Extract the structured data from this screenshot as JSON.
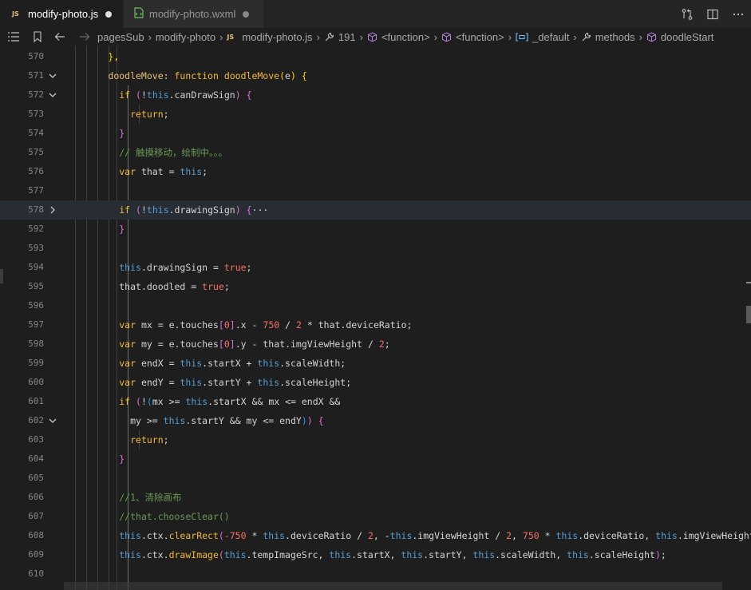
{
  "tabs": [
    {
      "label": "modify-photo.js",
      "icon": "javascript-file-icon",
      "active": true,
      "modified": true
    },
    {
      "label": "modify-photo.wxml",
      "icon": "wxml-file-icon",
      "active": false,
      "modified": true
    }
  ],
  "breadcrumb": [
    {
      "label": "pagesSub",
      "icon": ""
    },
    {
      "label": "modify-photo",
      "icon": ""
    },
    {
      "label": "modify-photo.js",
      "icon": "javascript-file-icon"
    },
    {
      "label": "191",
      "icon": "wrench-icon"
    },
    {
      "label": "<function>",
      "icon": "cube-icon"
    },
    {
      "label": "<function>",
      "icon": "cube-icon"
    },
    {
      "label": "_default",
      "icon": "variable-icon"
    },
    {
      "label": "methods",
      "icon": "wrench-icon"
    },
    {
      "label": "doodleStart",
      "icon": "cube-icon"
    }
  ],
  "colors": {
    "punctuation": "#d4d4d4",
    "keyword": "#569cd6",
    "storage": "#f5b83d",
    "property": "#e5c07b",
    "identifier": "#d4d4d4",
    "comment": "#6a9955",
    "function": "#f0b742",
    "number": "#f47067",
    "boolean": "#f47067",
    "bracket1": "#ffd700",
    "bracket2": "#da70d6",
    "bracket3": "#179fff",
    "operator": "#d4d4d4"
  },
  "current_line": 578,
  "lines": [
    {
      "n": 570,
      "fold": "",
      "tokens": [
        {
          "t": "        ",
          "c": "identifier"
        },
        {
          "t": "},",
          "c": "bracket1"
        }
      ]
    },
    {
      "n": 571,
      "fold": "open",
      "tokens": [
        {
          "t": "        ",
          "c": "identifier"
        },
        {
          "t": "doodleMove",
          "c": "property"
        },
        {
          "t": ": ",
          "c": "punctuation"
        },
        {
          "t": "function",
          "c": "storage"
        },
        {
          "t": " ",
          "c": "identifier"
        },
        {
          "t": "doodleMove",
          "c": "function"
        },
        {
          "t": "(",
          "c": "bracket1"
        },
        {
          "t": "e",
          "c": "identifier"
        },
        {
          "t": ")",
          "c": "bracket1"
        },
        {
          "t": " ",
          "c": "identifier"
        },
        {
          "t": "{",
          "c": "bracket1"
        }
      ]
    },
    {
      "n": 572,
      "fold": "open",
      "tokens": [
        {
          "t": "          ",
          "c": "identifier"
        },
        {
          "t": "if",
          "c": "storage"
        },
        {
          "t": " ",
          "c": "identifier"
        },
        {
          "t": "(",
          "c": "bracket2"
        },
        {
          "t": "!",
          "c": "operator"
        },
        {
          "t": "this",
          "c": "keyword"
        },
        {
          "t": ".canDrawSign",
          "c": "identifier"
        },
        {
          "t": ")",
          "c": "bracket2"
        },
        {
          "t": " ",
          "c": "identifier"
        },
        {
          "t": "{",
          "c": "bracket2"
        }
      ]
    },
    {
      "n": 573,
      "fold": "",
      "tokens": [
        {
          "t": "            ",
          "c": "identifier"
        },
        {
          "t": "return",
          "c": "storage"
        },
        {
          "t": ";",
          "c": "punctuation"
        }
      ]
    },
    {
      "n": 574,
      "fold": "",
      "tokens": [
        {
          "t": "          ",
          "c": "identifier"
        },
        {
          "t": "}",
          "c": "bracket2"
        }
      ]
    },
    {
      "n": 575,
      "fold": "",
      "tokens": [
        {
          "t": "          ",
          "c": "identifier"
        },
        {
          "t": "// 触摸移动，绘制中。。。",
          "c": "comment"
        }
      ]
    },
    {
      "n": 576,
      "fold": "",
      "tokens": [
        {
          "t": "          ",
          "c": "identifier"
        },
        {
          "t": "var",
          "c": "storage"
        },
        {
          "t": " that ",
          "c": "identifier"
        },
        {
          "t": "=",
          "c": "operator"
        },
        {
          "t": " ",
          "c": "identifier"
        },
        {
          "t": "this",
          "c": "keyword"
        },
        {
          "t": ";",
          "c": "punctuation"
        }
      ]
    },
    {
      "n": 577,
      "fold": "",
      "tokens": []
    },
    {
      "n": 578,
      "fold": "closed",
      "tokens": [
        {
          "t": "          ",
          "c": "identifier"
        },
        {
          "t": "if",
          "c": "storage"
        },
        {
          "t": " ",
          "c": "identifier"
        },
        {
          "t": "(",
          "c": "bracket2"
        },
        {
          "t": "!",
          "c": "operator"
        },
        {
          "t": "this",
          "c": "keyword"
        },
        {
          "t": ".drawingSign",
          "c": "identifier"
        },
        {
          "t": ")",
          "c": "bracket2"
        },
        {
          "t": " ",
          "c": "identifier"
        },
        {
          "t": "{",
          "c": "bracket2"
        },
        {
          "t": "···",
          "c": "identifier"
        }
      ]
    },
    {
      "n": 592,
      "fold": "",
      "tokens": [
        {
          "t": "          ",
          "c": "identifier"
        },
        {
          "t": "}",
          "c": "bracket2"
        }
      ]
    },
    {
      "n": 593,
      "fold": "",
      "tokens": []
    },
    {
      "n": 594,
      "fold": "",
      "tokens": [
        {
          "t": "          ",
          "c": "identifier"
        },
        {
          "t": "this",
          "c": "keyword"
        },
        {
          "t": ".drawingSign ",
          "c": "identifier"
        },
        {
          "t": "=",
          "c": "operator"
        },
        {
          "t": " ",
          "c": "identifier"
        },
        {
          "t": "true",
          "c": "boolean"
        },
        {
          "t": ";",
          "c": "punctuation"
        }
      ]
    },
    {
      "n": 595,
      "fold": "",
      "tokens": [
        {
          "t": "          ",
          "c": "identifier"
        },
        {
          "t": "that.doodled ",
          "c": "identifier"
        },
        {
          "t": "=",
          "c": "operator"
        },
        {
          "t": " ",
          "c": "identifier"
        },
        {
          "t": "true",
          "c": "boolean"
        },
        {
          "t": ";",
          "c": "punctuation"
        }
      ]
    },
    {
      "n": 596,
      "fold": "",
      "tokens": []
    },
    {
      "n": 597,
      "fold": "",
      "tokens": [
        {
          "t": "          ",
          "c": "identifier"
        },
        {
          "t": "var",
          "c": "storage"
        },
        {
          "t": " mx ",
          "c": "identifier"
        },
        {
          "t": "=",
          "c": "operator"
        },
        {
          "t": " e.touches",
          "c": "identifier"
        },
        {
          "t": "[",
          "c": "bracket2"
        },
        {
          "t": "0",
          "c": "number"
        },
        {
          "t": "]",
          "c": "bracket2"
        },
        {
          "t": ".x ",
          "c": "identifier"
        },
        {
          "t": "-",
          "c": "operator"
        },
        {
          "t": " ",
          "c": "identifier"
        },
        {
          "t": "750",
          "c": "number"
        },
        {
          "t": " ",
          "c": "identifier"
        },
        {
          "t": "/",
          "c": "operator"
        },
        {
          "t": " ",
          "c": "identifier"
        },
        {
          "t": "2",
          "c": "number"
        },
        {
          "t": " ",
          "c": "identifier"
        },
        {
          "t": "*",
          "c": "operator"
        },
        {
          "t": " that.deviceRatio",
          "c": "identifier"
        },
        {
          "t": ";",
          "c": "punctuation"
        }
      ]
    },
    {
      "n": 598,
      "fold": "",
      "tokens": [
        {
          "t": "          ",
          "c": "identifier"
        },
        {
          "t": "var",
          "c": "storage"
        },
        {
          "t": " my ",
          "c": "identifier"
        },
        {
          "t": "=",
          "c": "operator"
        },
        {
          "t": " e.touches",
          "c": "identifier"
        },
        {
          "t": "[",
          "c": "bracket2"
        },
        {
          "t": "0",
          "c": "number"
        },
        {
          "t": "]",
          "c": "bracket2"
        },
        {
          "t": ".y ",
          "c": "identifier"
        },
        {
          "t": "-",
          "c": "operator"
        },
        {
          "t": " that.imgViewHeight ",
          "c": "identifier"
        },
        {
          "t": "/",
          "c": "operator"
        },
        {
          "t": " ",
          "c": "identifier"
        },
        {
          "t": "2",
          "c": "number"
        },
        {
          "t": ";",
          "c": "punctuation"
        }
      ]
    },
    {
      "n": 599,
      "fold": "",
      "tokens": [
        {
          "t": "          ",
          "c": "identifier"
        },
        {
          "t": "var",
          "c": "storage"
        },
        {
          "t": " endX ",
          "c": "identifier"
        },
        {
          "t": "=",
          "c": "operator"
        },
        {
          "t": " ",
          "c": "identifier"
        },
        {
          "t": "this",
          "c": "keyword"
        },
        {
          "t": ".startX ",
          "c": "identifier"
        },
        {
          "t": "+",
          "c": "operator"
        },
        {
          "t": " ",
          "c": "identifier"
        },
        {
          "t": "this",
          "c": "keyword"
        },
        {
          "t": ".scaleWidth",
          "c": "identifier"
        },
        {
          "t": ";",
          "c": "punctuation"
        }
      ]
    },
    {
      "n": 600,
      "fold": "",
      "tokens": [
        {
          "t": "          ",
          "c": "identifier"
        },
        {
          "t": "var",
          "c": "storage"
        },
        {
          "t": " endY ",
          "c": "identifier"
        },
        {
          "t": "=",
          "c": "operator"
        },
        {
          "t": " ",
          "c": "identifier"
        },
        {
          "t": "this",
          "c": "keyword"
        },
        {
          "t": ".startY ",
          "c": "identifier"
        },
        {
          "t": "+",
          "c": "operator"
        },
        {
          "t": " ",
          "c": "identifier"
        },
        {
          "t": "this",
          "c": "keyword"
        },
        {
          "t": ".scaleHeight",
          "c": "identifier"
        },
        {
          "t": ";",
          "c": "punctuation"
        }
      ]
    },
    {
      "n": 601,
      "fold": "",
      "tokens": [
        {
          "t": "          ",
          "c": "identifier"
        },
        {
          "t": "if",
          "c": "storage"
        },
        {
          "t": " ",
          "c": "identifier"
        },
        {
          "t": "(",
          "c": "bracket2"
        },
        {
          "t": "!",
          "c": "operator"
        },
        {
          "t": "(",
          "c": "bracket3"
        },
        {
          "t": "mx ",
          "c": "identifier"
        },
        {
          "t": ">=",
          "c": "operator"
        },
        {
          "t": " ",
          "c": "identifier"
        },
        {
          "t": "this",
          "c": "keyword"
        },
        {
          "t": ".startX ",
          "c": "identifier"
        },
        {
          "t": "&&",
          "c": "operator"
        },
        {
          "t": " mx ",
          "c": "identifier"
        },
        {
          "t": "<=",
          "c": "operator"
        },
        {
          "t": " endX ",
          "c": "identifier"
        },
        {
          "t": "&&",
          "c": "operator"
        }
      ]
    },
    {
      "n": 602,
      "fold": "open",
      "tokens": [
        {
          "t": "            ",
          "c": "identifier"
        },
        {
          "t": "my ",
          "c": "identifier"
        },
        {
          "t": ">=",
          "c": "operator"
        },
        {
          "t": " ",
          "c": "identifier"
        },
        {
          "t": "this",
          "c": "keyword"
        },
        {
          "t": ".startY ",
          "c": "identifier"
        },
        {
          "t": "&&",
          "c": "operator"
        },
        {
          "t": " my ",
          "c": "identifier"
        },
        {
          "t": "<=",
          "c": "operator"
        },
        {
          "t": " endY",
          "c": "identifier"
        },
        {
          "t": ")",
          "c": "bracket3"
        },
        {
          "t": ")",
          "c": "bracket2"
        },
        {
          "t": " ",
          "c": "identifier"
        },
        {
          "t": "{",
          "c": "bracket2"
        }
      ]
    },
    {
      "n": 603,
      "fold": "",
      "tokens": [
        {
          "t": "            ",
          "c": "identifier"
        },
        {
          "t": "return",
          "c": "storage"
        },
        {
          "t": ";",
          "c": "punctuation"
        }
      ]
    },
    {
      "n": 604,
      "fold": "",
      "tokens": [
        {
          "t": "          ",
          "c": "identifier"
        },
        {
          "t": "}",
          "c": "bracket2"
        }
      ]
    },
    {
      "n": 605,
      "fold": "",
      "tokens": []
    },
    {
      "n": 606,
      "fold": "",
      "tokens": [
        {
          "t": "          ",
          "c": "identifier"
        },
        {
          "t": "//1、清除画布",
          "c": "comment"
        }
      ]
    },
    {
      "n": 607,
      "fold": "",
      "tokens": [
        {
          "t": "          ",
          "c": "identifier"
        },
        {
          "t": "//that.chooseClear()",
          "c": "comment"
        }
      ]
    },
    {
      "n": 608,
      "fold": "",
      "tokens": [
        {
          "t": "          ",
          "c": "identifier"
        },
        {
          "t": "this",
          "c": "keyword"
        },
        {
          "t": ".ctx.",
          "c": "identifier"
        },
        {
          "t": "clearRect",
          "c": "function"
        },
        {
          "t": "(",
          "c": "bracket2"
        },
        {
          "t": "-750",
          "c": "number"
        },
        {
          "t": " ",
          "c": "identifier"
        },
        {
          "t": "*",
          "c": "operator"
        },
        {
          "t": " ",
          "c": "identifier"
        },
        {
          "t": "this",
          "c": "keyword"
        },
        {
          "t": ".deviceRatio ",
          "c": "identifier"
        },
        {
          "t": "/",
          "c": "operator"
        },
        {
          "t": " ",
          "c": "identifier"
        },
        {
          "t": "2",
          "c": "number"
        },
        {
          "t": ", ",
          "c": "punctuation"
        },
        {
          "t": "-",
          "c": "operator"
        },
        {
          "t": "this",
          "c": "keyword"
        },
        {
          "t": ".imgViewHeight ",
          "c": "identifier"
        },
        {
          "t": "/",
          "c": "operator"
        },
        {
          "t": " ",
          "c": "identifier"
        },
        {
          "t": "2",
          "c": "number"
        },
        {
          "t": ", ",
          "c": "punctuation"
        },
        {
          "t": "750",
          "c": "number"
        },
        {
          "t": " ",
          "c": "identifier"
        },
        {
          "t": "*",
          "c": "operator"
        },
        {
          "t": " ",
          "c": "identifier"
        },
        {
          "t": "this",
          "c": "keyword"
        },
        {
          "t": ".deviceRatio, ",
          "c": "identifier"
        },
        {
          "t": "this",
          "c": "keyword"
        },
        {
          "t": ".imgViewHeight",
          "c": "identifier"
        },
        {
          "t": ")",
          "c": "bracket2"
        },
        {
          "t": ";",
          "c": "punctuation"
        }
      ]
    },
    {
      "n": 609,
      "fold": "",
      "tokens": [
        {
          "t": "          ",
          "c": "identifier"
        },
        {
          "t": "this",
          "c": "keyword"
        },
        {
          "t": ".ctx.",
          "c": "identifier"
        },
        {
          "t": "drawImage",
          "c": "function"
        },
        {
          "t": "(",
          "c": "bracket2"
        },
        {
          "t": "this",
          "c": "keyword"
        },
        {
          "t": ".tempImageSrc, ",
          "c": "identifier"
        },
        {
          "t": "this",
          "c": "keyword"
        },
        {
          "t": ".startX, ",
          "c": "identifier"
        },
        {
          "t": "this",
          "c": "keyword"
        },
        {
          "t": ".startY, ",
          "c": "identifier"
        },
        {
          "t": "this",
          "c": "keyword"
        },
        {
          "t": ".scaleWidth, ",
          "c": "identifier"
        },
        {
          "t": "this",
          "c": "keyword"
        },
        {
          "t": ".scaleHeight",
          "c": "identifier"
        },
        {
          "t": ")",
          "c": "bracket2"
        },
        {
          "t": ";",
          "c": "punctuation"
        }
      ]
    },
    {
      "n": 610,
      "fold": "",
      "tokens": []
    }
  ]
}
